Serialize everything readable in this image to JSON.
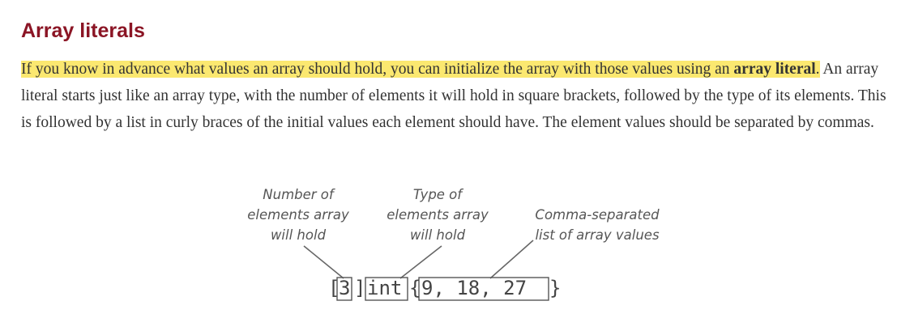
{
  "heading": "Array literals",
  "paragraph": {
    "highlight_text": "If you know in advance what values an array should hold, you can initialize the array with those values using an ",
    "highlight_bold": "array literal",
    "highlight_end": ".",
    "rest": " An array literal starts just like an array type, with the number of elements it will hold in square brackets, followed by the type of its elements. This is followed by a list in curly braces of the initial values each element should have. The element values should be separated by commas."
  },
  "diagram": {
    "callouts": {
      "count": [
        "Number of",
        "elements array",
        "will hold"
      ],
      "type": [
        "Type of",
        "elements array",
        "will hold"
      ],
      "values": [
        "Comma-separated",
        "list of array values"
      ]
    },
    "code": {
      "open_bracket": "[",
      "count": "3",
      "close_bracket": "]",
      "type": "int",
      "open_brace": "{",
      "values": "9, 18, 27",
      "close_brace": "}"
    }
  },
  "colors": {
    "heading": "#8b1525",
    "highlight": "#fbe870",
    "text": "#333333"
  }
}
